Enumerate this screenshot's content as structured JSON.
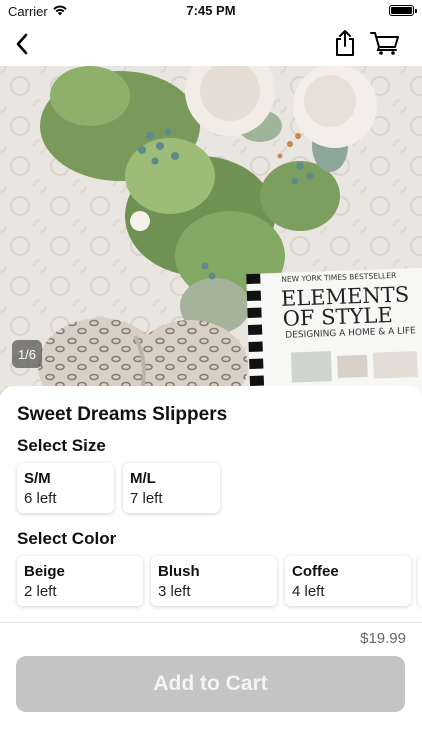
{
  "status_bar": {
    "carrier": "Carrier",
    "time": "7:45 PM"
  },
  "nav": {
    "back_icon": "chevron-left-icon",
    "share_icon": "share-icon",
    "cart_icon": "shopping-cart-icon"
  },
  "gallery": {
    "page_indicator": "1/6",
    "book_lines": [
      "NEW YORK TIMES BESTSELLER",
      "ELEMENTS",
      "OF STYLE",
      "DESIGNING A HOME & A LIFE"
    ]
  },
  "product": {
    "title": "Sweet Dreams Slippers",
    "size_label": "Select Size",
    "sizes": [
      {
        "name": "S/M",
        "stock": "6 left"
      },
      {
        "name": "M/L",
        "stock": "7 left"
      }
    ],
    "color_label": "Select Color",
    "colors": [
      {
        "name": "Beige",
        "stock": "2 left"
      },
      {
        "name": "Blush",
        "stock": "3 left"
      },
      {
        "name": "Coffee",
        "stock": "4 left"
      }
    ]
  },
  "footer": {
    "price": "$19.99",
    "add_to_cart_label": "Add to Cart"
  },
  "colors": {
    "button_disabled": "#c4c4c4",
    "button_text": "#f4f4f4",
    "price_text": "#666666"
  }
}
